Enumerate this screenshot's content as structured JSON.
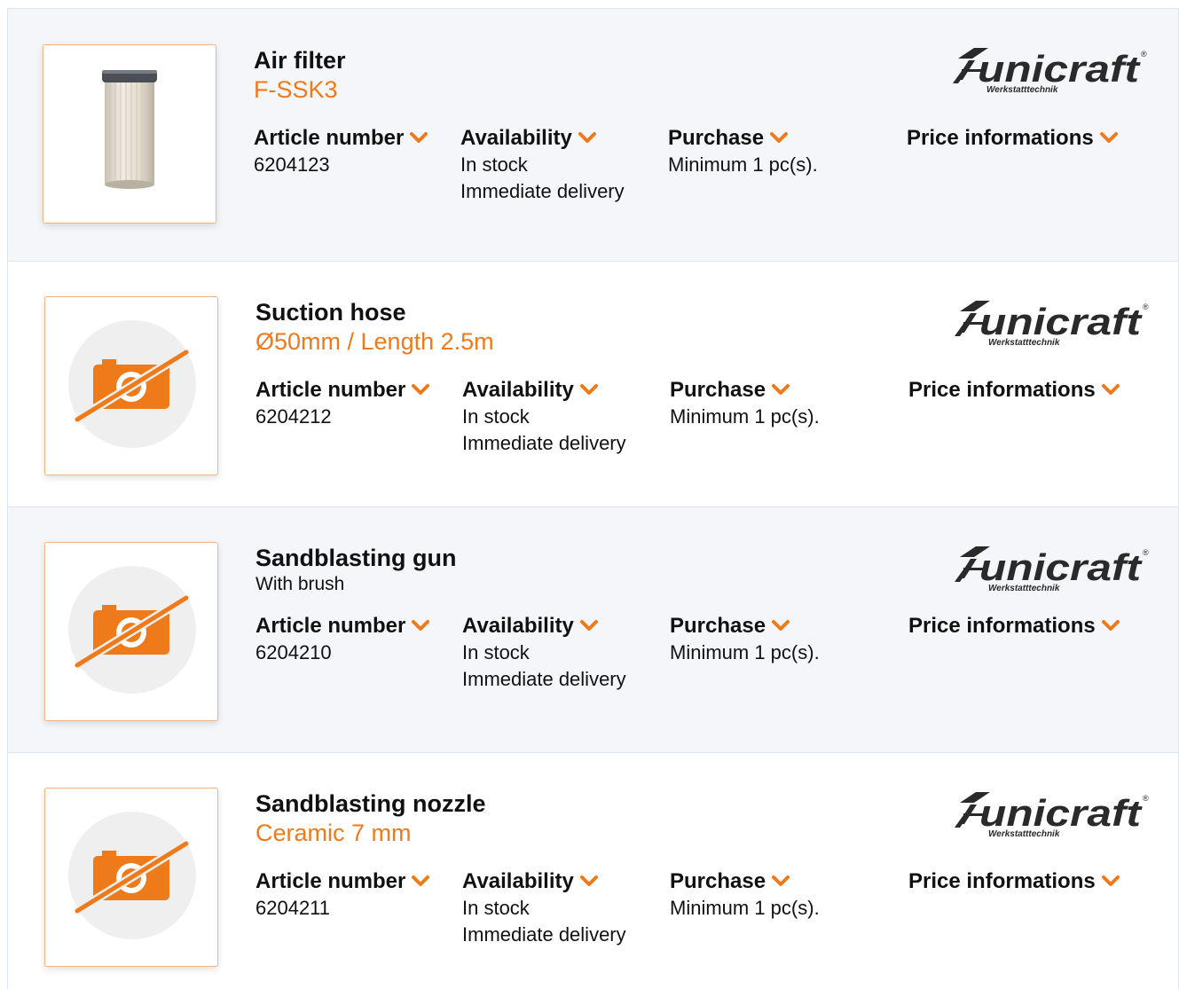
{
  "accent_color": "#ef7a1a",
  "brand": {
    "name": "unicraft",
    "tagline": "Werkstatttechnik"
  },
  "labels": {
    "article_number": "Article number",
    "availability": "Availability",
    "purchase": "Purchase",
    "price_informations": "Price informations"
  },
  "products": [
    {
      "name": "Air filter",
      "subtitle": "F-SSK3",
      "article_number": "6204123",
      "availability_status": "In stock",
      "availability_delivery": "Immediate delivery",
      "purchase": "Minimum 1 pc(s).",
      "image": "air-filter-photo"
    },
    {
      "name": "Suction hose",
      "subtitle": "Ø50mm / Length 2.5m",
      "article_number": "6204212",
      "availability_status": "In stock",
      "availability_delivery": "Immediate delivery",
      "purchase": "Minimum 1 pc(s).",
      "image": "no-image-icon"
    },
    {
      "name": "Sandblasting gun",
      "subtitle": "With brush",
      "article_number": "6204210",
      "availability_status": "In stock",
      "availability_delivery": "Immediate delivery",
      "purchase": "Minimum 1 pc(s).",
      "image": "no-image-icon"
    },
    {
      "name": "Sandblasting nozzle",
      "subtitle": "Ceramic 7 mm",
      "article_number": "6204211",
      "availability_status": "In stock",
      "availability_delivery": "Immediate delivery",
      "purchase": "Minimum 1 pc(s).",
      "image": "no-image-icon"
    }
  ]
}
